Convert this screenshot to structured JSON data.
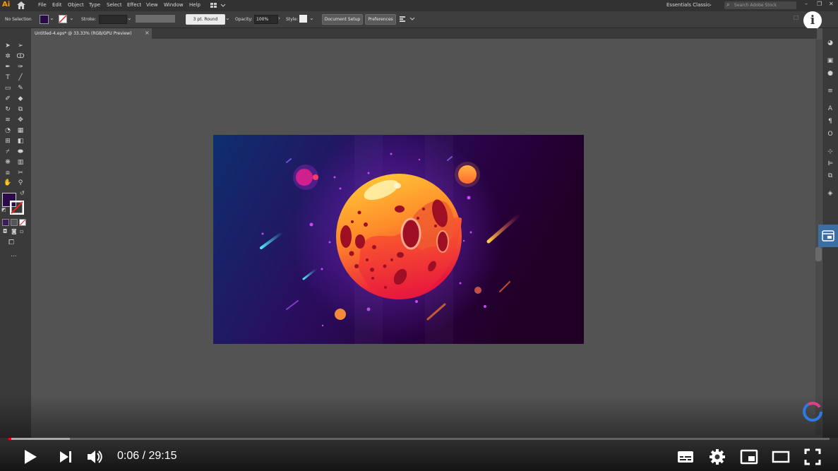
{
  "app": {
    "logo": "Ai"
  },
  "menu": [
    "File",
    "Edit",
    "Object",
    "Type",
    "Select",
    "Effect",
    "View",
    "Window",
    "Help"
  ],
  "workspace": {
    "label": "Essentials Classic"
  },
  "search": {
    "placeholder": "Search Adobe Stock"
  },
  "control_bar": {
    "selection": "No Selection",
    "stroke_label": "Stroke:",
    "brush_label": "3 pt. Round",
    "opacity_label": "Opacity:",
    "opacity_value": "100%",
    "style_label": "Style:",
    "document_setup": "Document Setup",
    "preferences": "Preferences"
  },
  "document_tab": {
    "title": "Untitled-4.eps* @ 33.33% (RGB/GPU Preview)",
    "close": "×"
  },
  "info_button": {
    "label": "i"
  },
  "tools_more": "...",
  "player": {
    "current_time": "0:06",
    "separator": " / ",
    "duration": "29:15",
    "progress_fraction": 0.0034,
    "buffered_fraction": 0.075
  },
  "colors": {
    "fill_swatch": "#2b0a4a",
    "progress": "#ff0000",
    "planet_top": "#ffd13a",
    "planet_bottom": "#e8173c",
    "space_left": "#0e2f6e",
    "space_right": "#2a0028"
  }
}
